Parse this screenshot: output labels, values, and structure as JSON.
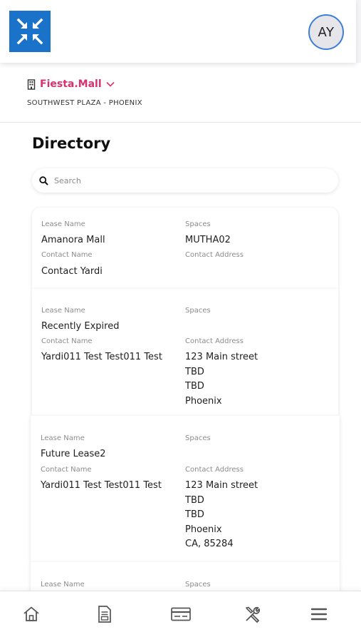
{
  "header": {
    "avatar_initials": "AY",
    "brand_color": "#1a73c8"
  },
  "property": {
    "mall_name": "Fiesta.Mall",
    "subtitle": "SOUTHWEST PLAZA - PHOENIX",
    "accent_color": "#d7316f"
  },
  "page": {
    "title": "Directory"
  },
  "search": {
    "placeholder": "Search"
  },
  "labels": {
    "lease_name": "Lease Name",
    "spaces": "Spaces",
    "contact_name": "Contact Name",
    "contact_address": "Contact Address"
  },
  "leases": [
    {
      "lease_name": "Amanora Mall",
      "spaces": "MUTHA02",
      "contact_name": "Contact Yardi",
      "address": []
    },
    {
      "lease_name": "Recently Expired",
      "spaces": "",
      "contact_name": "Yardi011 Test Test011 Test",
      "address": [
        "123 Main street",
        "TBD",
        "TBD",
        "Phoenix"
      ]
    },
    {
      "lease_name": "Future Lease2",
      "spaces": "",
      "contact_name": "Yardi011 Test Test011 Test",
      "address": [
        "123 Main street",
        "TBD",
        "TBD",
        "Phoenix",
        "CA, 85284"
      ]
    },
    {
      "lease_name": "",
      "spaces": "",
      "contact_name": "",
      "address": []
    }
  ],
  "bottom_nav": [
    {
      "icon": "home-icon"
    },
    {
      "icon": "document-icon"
    },
    {
      "icon": "card-icon"
    },
    {
      "icon": "tools-icon"
    },
    {
      "icon": "menu-icon"
    }
  ]
}
